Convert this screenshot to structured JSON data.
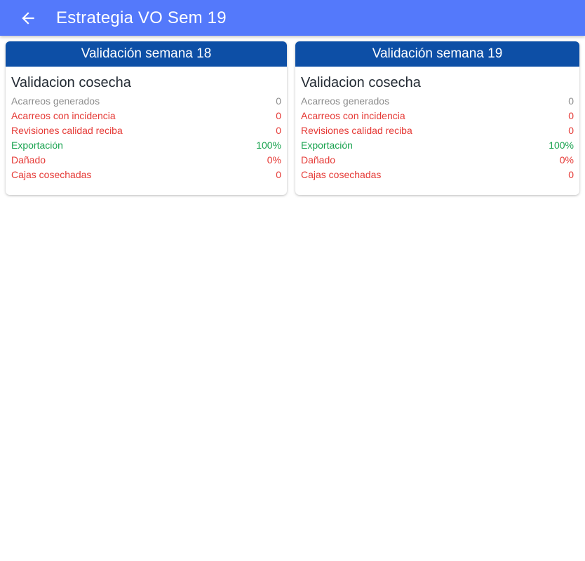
{
  "appbar": {
    "title": "Estrategia VO Sem 19",
    "back_icon": "arrow-back-icon",
    "color": "#5479fb"
  },
  "colors": {
    "card_header": "#0d4fa6",
    "neutral": "#8c8c8c",
    "negative": "#e53935",
    "positive": "#1aa350"
  },
  "cards": [
    {
      "header": "Validación semana 18",
      "section_title": "Validacion cosecha",
      "rows": [
        {
          "label": "Acarreos generados",
          "value": "0",
          "status": "gray"
        },
        {
          "label": "Acarreos con incidencia",
          "value": "0",
          "status": "red"
        },
        {
          "label": "Revisiones calidad reciba",
          "value": "0",
          "status": "red"
        },
        {
          "label": "Exportación",
          "value": "100%",
          "status": "green"
        },
        {
          "label": "Dañado",
          "value": "0%",
          "status": "red"
        },
        {
          "label": "Cajas cosechadas",
          "value": "0",
          "status": "red"
        }
      ]
    },
    {
      "header": "Validación semana 19",
      "section_title": "Validacion cosecha",
      "rows": [
        {
          "label": "Acarreos generados",
          "value": "0",
          "status": "gray"
        },
        {
          "label": "Acarreos con incidencia",
          "value": "0",
          "status": "red"
        },
        {
          "label": "Revisiones calidad reciba",
          "value": "0",
          "status": "red"
        },
        {
          "label": "Exportación",
          "value": "100%",
          "status": "green"
        },
        {
          "label": "Dañado",
          "value": "0%",
          "status": "red"
        },
        {
          "label": "Cajas cosechadas",
          "value": "0",
          "status": "red"
        }
      ]
    }
  ]
}
